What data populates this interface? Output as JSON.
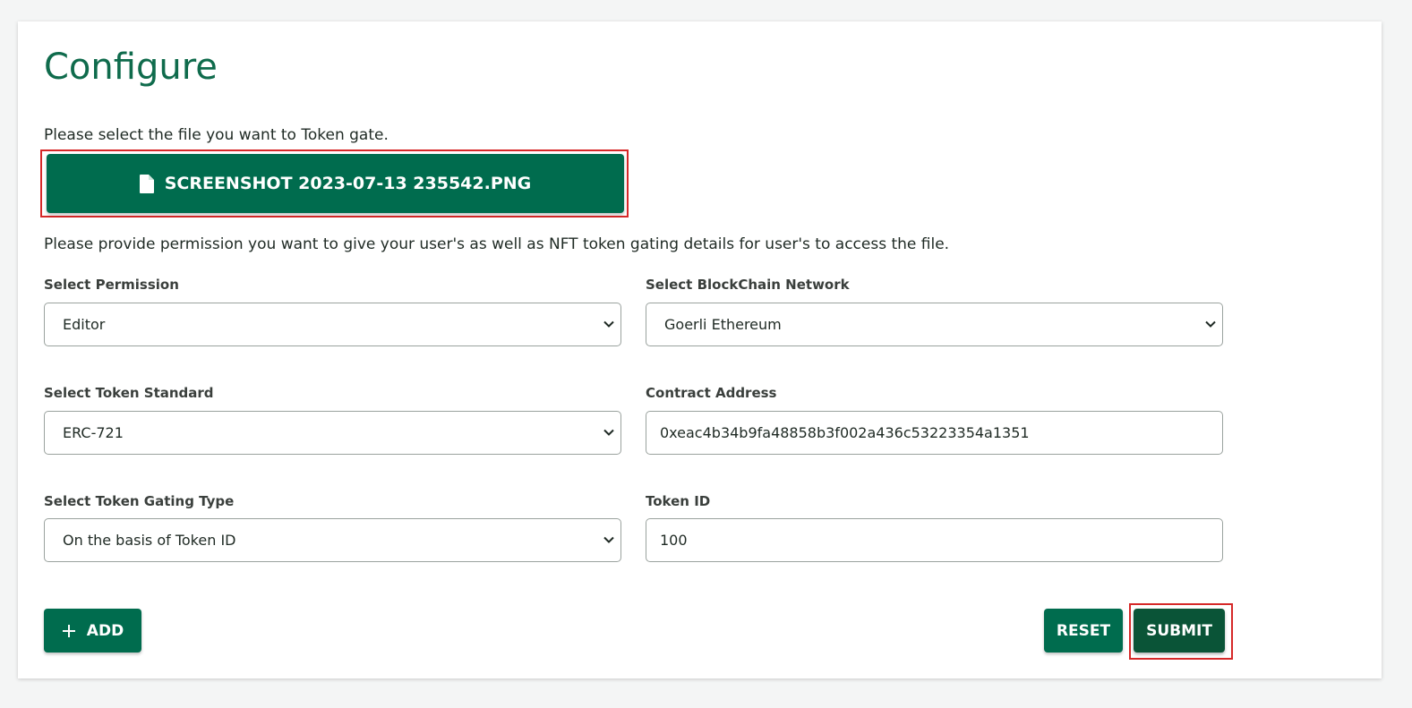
{
  "page": {
    "title": "Configure",
    "file_instruction": "Please select the file you want to Token gate.",
    "permission_instruction": "Please provide permission you want to give your user's as well as NFT token gating details for user's to access the file."
  },
  "file_button": {
    "label": "SCREENSHOT 2023-07-13 235542.PNG",
    "icon": "file-icon"
  },
  "fields": {
    "permission": {
      "label": "Select Permission",
      "value": "Editor"
    },
    "network": {
      "label": "Select BlockChain Network",
      "value": "Goerli Ethereum"
    },
    "token_standard": {
      "label": "Select Token Standard",
      "value": "ERC-721"
    },
    "contract_address": {
      "label": "Contract Address",
      "value": "0xeac4b34b9fa48858b3f002a436c53223354a1351"
    },
    "gating_type": {
      "label": "Select Token Gating Type",
      "value": "On the basis of Token ID"
    },
    "token_id": {
      "label": "Token ID",
      "value": "100"
    }
  },
  "actions": {
    "add_label": "ADD",
    "reset_label": "RESET",
    "submit_label": "SUBMIT"
  },
  "colors": {
    "primary": "#006c4e",
    "submit": "#0a5437",
    "title": "#0f6b4c",
    "highlight": "#d62828"
  }
}
